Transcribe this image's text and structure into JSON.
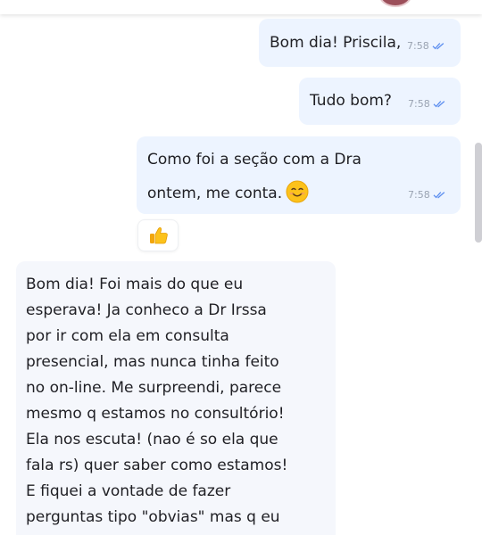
{
  "messages_outgoing": [
    {
      "text": "Bom dia! Priscila,",
      "time": "7:58"
    },
    {
      "text": "Tudo bom?",
      "time": "7:58"
    },
    {
      "line1": "Como foi a seção com a Dra",
      "line2": "ontem, me conta.",
      "emoji": "smiling-face-emoji",
      "time": "7:58"
    }
  ],
  "reaction": {
    "emoji": "thumbs-up-emoji"
  },
  "message_incoming": {
    "lines": [
      "Bom dia! Foi mais do que eu",
      "esperava! Ja conheco a Dr Irssa",
      "por ir com ela em consulta",
      "presencial, mas nunca tinha feito",
      "no on-line. Me surpreendi, parece",
      "mesmo q estamos no consultório!",
      "Ela nos escuta! (nao é so ela que",
      "fala rs) quer saber como estamos!",
      "E fiquei a vontade de fazer",
      "perguntas tipo \"obvias\" mas q eu"
    ]
  },
  "colors": {
    "outgoing_bubble": "#edf4ff",
    "incoming_bubble": "#f5f7fc",
    "read_ticks": "#5b8def",
    "text": "#1f1f24"
  }
}
